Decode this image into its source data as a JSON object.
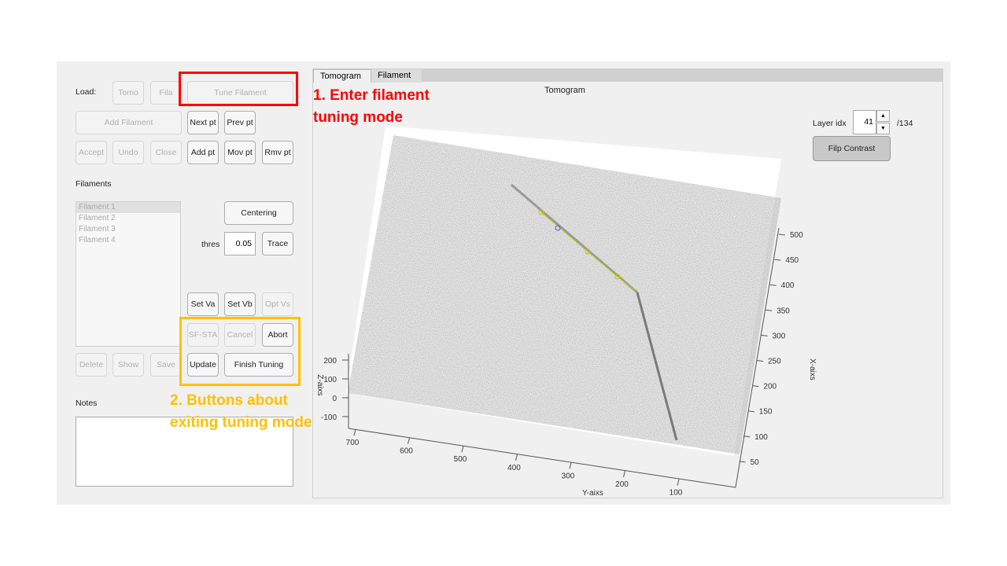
{
  "left": {
    "load_label": "Load:",
    "tomo": "Tomo",
    "fila": "Fila",
    "tune_filament": "Tune Filament",
    "add_filament": "Add Filament",
    "next_pt": "Next pt",
    "prev_pt": "Prev pt",
    "accept": "Accept",
    "undo": "Undo",
    "close": "Close",
    "add_pt": "Add pt",
    "mov_pt": "Mov pt",
    "rmv_pt": "Rmv pt",
    "filaments_label": "Filaments",
    "filaments": [
      "Filament 1",
      "Filament 2",
      "Filament 3",
      "Filament 4"
    ],
    "centering": "Centering",
    "thres_label": "thres",
    "thres_value": "0.05",
    "trace": "Trace",
    "set_va": "Set Va",
    "set_vb": "Set Vb",
    "opt_vs": "Opt Vs",
    "sf_sta": "SF-STA",
    "cancel": "Cancel",
    "abort": "Abort",
    "delete": "Delete",
    "show": "Show",
    "save": "Save",
    "update": "Update",
    "finish_tuning": "Finish Tuning",
    "notes_label": "Notes",
    "notes_value": ""
  },
  "right": {
    "tabs": [
      "Tomogram",
      "Filament"
    ],
    "active_tab": "Tomogram",
    "plot_title": "Tomogram",
    "layer_label": "Layer idx",
    "layer_value": "41",
    "layer_total": "/134",
    "flip_contrast": "Filp Contrast",
    "y_axis_label": "Y-aixs",
    "x_axis_label": "X-aixs",
    "z_axis_label": "Z-aixs",
    "y_ticks": [
      "700",
      "600",
      "500",
      "400",
      "300",
      "200",
      "100"
    ],
    "x_ticks": [
      "500",
      "450",
      "400",
      "350",
      "300",
      "250",
      "200",
      "150",
      "100",
      "50"
    ],
    "z_ticks": [
      "200",
      "100",
      "0",
      "-100"
    ]
  },
  "annotations": {
    "a1": "1. Enter filament tuning mode",
    "a2": "2. Buttons about exiting tuning mode",
    "red": "#ff0000",
    "orange": "#ffc000"
  }
}
